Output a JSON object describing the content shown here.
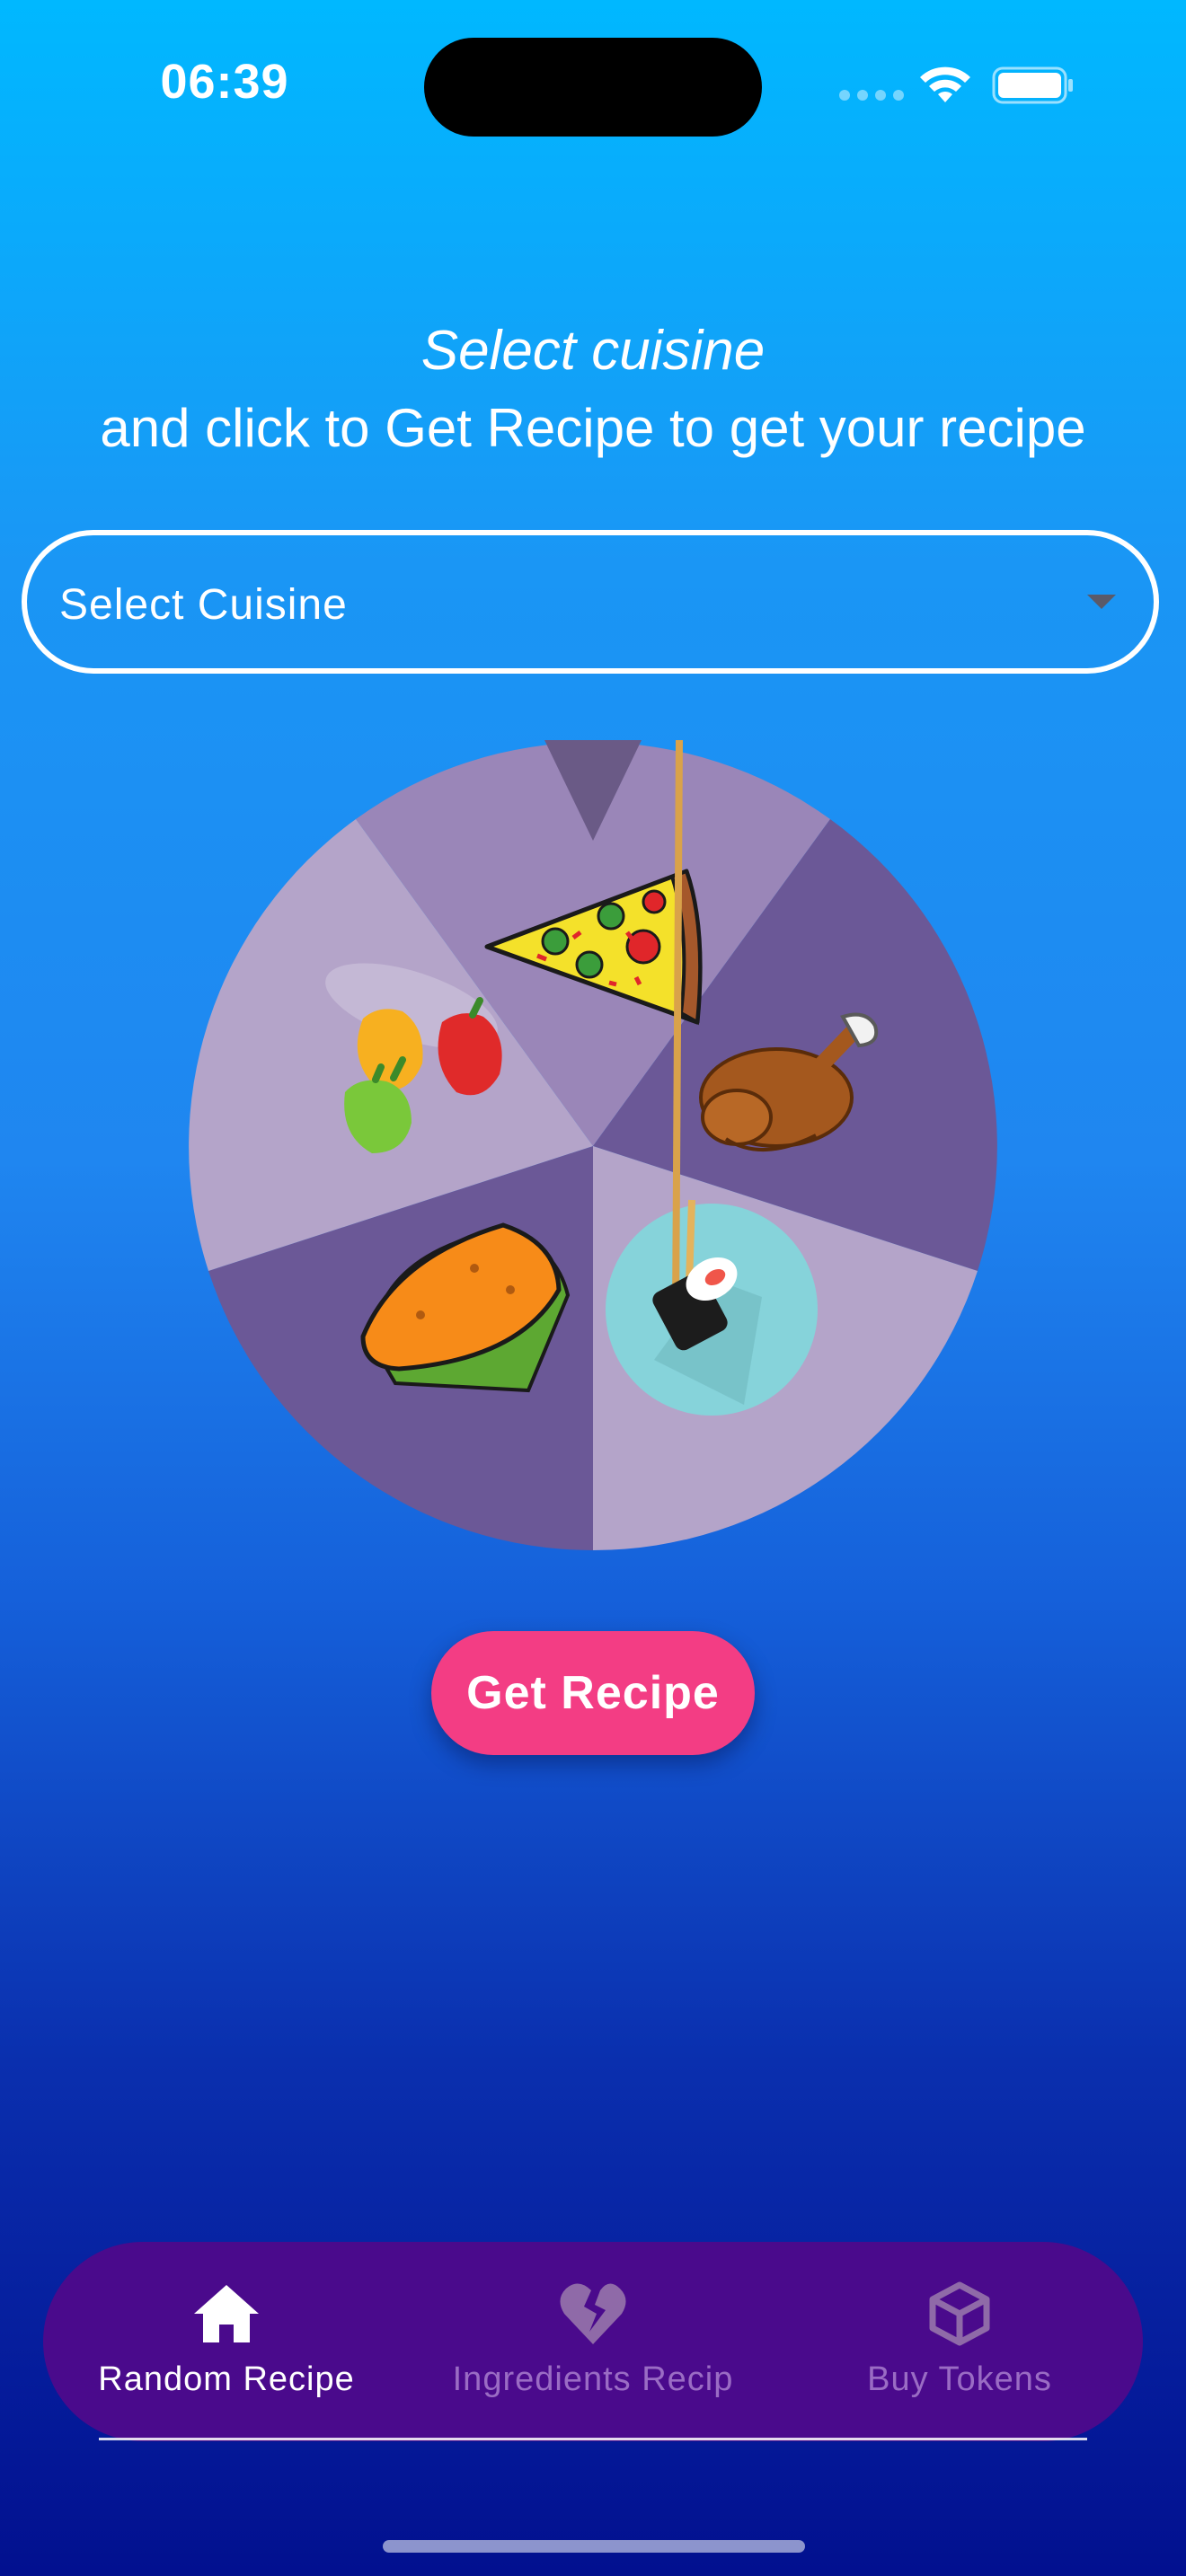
{
  "status_bar": {
    "time": "06:39"
  },
  "header": {
    "line1": "Select cuisine",
    "line2": "and click to Get Recipe to get your recipe"
  },
  "cuisine_select": {
    "placeholder": "Select Cuisine",
    "caret_icon": "caret-down-icon"
  },
  "wheel": {
    "segments": [
      {
        "food_icon": "pizza-icon",
        "color": "#9a86b8"
      },
      {
        "food_icon": "roast-chicken-icon",
        "color": "#6b5897"
      },
      {
        "food_icon": "sushi-icon",
        "color": "#b4a4c9"
      },
      {
        "food_icon": "taco-icon",
        "color": "#6b5897"
      },
      {
        "food_icon": "peppers-icon",
        "color": "#b4a4c9"
      }
    ],
    "pointer_icon": "wheel-pointer-icon"
  },
  "action": {
    "get_recipe_label": "Get Recipe",
    "color": "#f33d84"
  },
  "bottom_nav": {
    "items": [
      {
        "label": "Random Recipe",
        "icon": "home-icon",
        "active": true
      },
      {
        "label": "Ingredients Recip",
        "icon": "broken-heart-icon",
        "active": false
      },
      {
        "label": "Buy Tokens",
        "icon": "cube-icon",
        "active": false
      }
    ],
    "background": "#4a0a8c"
  }
}
